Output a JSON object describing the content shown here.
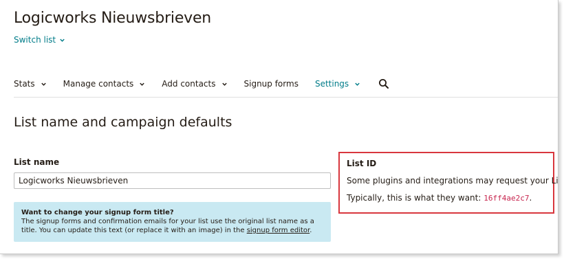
{
  "header": {
    "title": "Logicworks Nieuwsbrieven",
    "switch_list_label": "Switch list"
  },
  "nav": {
    "items": [
      {
        "label": "Stats",
        "dropdown": true
      },
      {
        "label": "Manage contacts",
        "dropdown": true
      },
      {
        "label": "Add contacts",
        "dropdown": true
      },
      {
        "label": "Signup forms",
        "dropdown": false
      },
      {
        "label": "Settings",
        "dropdown": true,
        "active": true
      }
    ],
    "search_icon": "search-icon"
  },
  "main": {
    "section_title": "List name and campaign defaults",
    "list_name": {
      "label": "List name",
      "value": "Logicworks Nieuwsbrieven"
    },
    "info": {
      "title": "Want to change your signup form title?",
      "text_before_link": "The signup forms and confirmation emails for your list use the original list name as a title. You can update this text (or replace it with an image) in the ",
      "link_text": "signup form editor",
      "text_after_link": "."
    },
    "list_id": {
      "title": "List ID",
      "line1": "Some plugins and integrations may request your List ID.",
      "line2_prefix": "Typically, this is what they want: ",
      "id_value": "16ff4ae2c7",
      "line2_suffix": "."
    }
  },
  "colors": {
    "accent": "#007c89",
    "highlight_border": "#d8363d",
    "info_background": "#c9e9f2",
    "code_text": "#c7254e"
  }
}
